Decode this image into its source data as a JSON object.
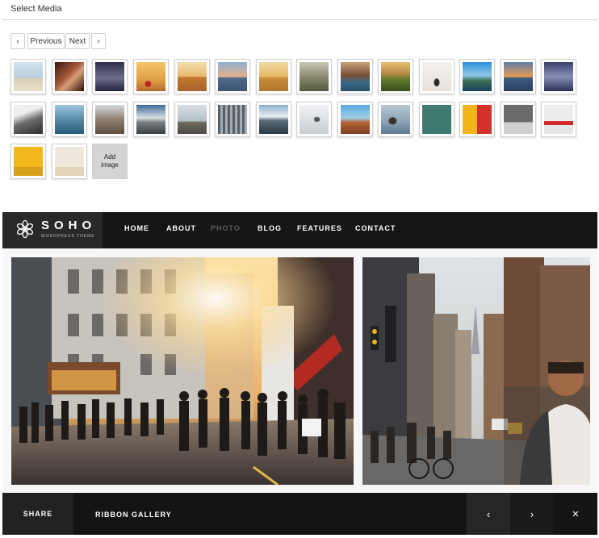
{
  "media": {
    "title": "Select Media",
    "previous_label": "Previous",
    "next_label": "Next",
    "add_image_label": "Add image",
    "thumbnails": [
      "beach-pelicans",
      "red-leaves",
      "dusk-sea",
      "berries-still-life",
      "desert-sand",
      "sunset-coast",
      "golden-field",
      "misty-valley",
      "rocky-shore",
      "hillside-sunset",
      "sea-rock",
      "cliff-sky",
      "ocean-horizon",
      "blue-dusk-sea",
      "mountain-mist",
      "lake-cliffs",
      "rocky-hills",
      "snowy-peaks",
      "coastal-rocks",
      "forest-fog",
      "mountain-lake",
      "pelican-mist",
      "canyon-sunset",
      "sea-stacks",
      "birds-teal-sky",
      "yellow-red-room",
      "grey-interior",
      "red-sofa-room",
      "yellow-chair-room",
      "cream-wall-room"
    ]
  },
  "theme": {
    "brand": "SOHO",
    "tagline": "WORDPRESS THEME",
    "nav": [
      "HOME",
      "ABOUT",
      "PHOTO",
      "BLOG",
      "FEATURES",
      "CONTACT"
    ],
    "active_nav": "PHOTO",
    "share_label": "SHARE",
    "gallery_label": "RIBBON GALLERY",
    "prev_icon": "‹",
    "next_icon": "›",
    "close_icon": "✕",
    "colors": {
      "nav_bg": "#151515",
      "logo_bg": "#292929",
      "footer_bg": "#141414",
      "nav_inactive": "#5e5e5e"
    }
  }
}
